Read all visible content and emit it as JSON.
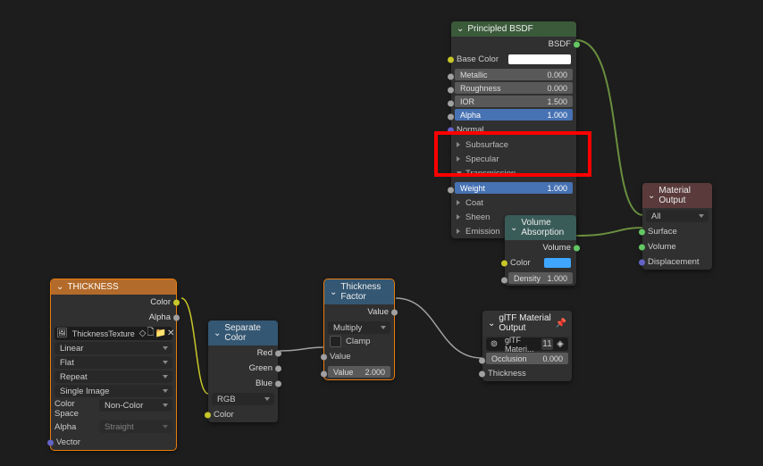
{
  "bsdf": {
    "title": "Principled BSDF",
    "out": "BSDF",
    "base_color_label": "Base Color",
    "base_color": "#ffffff",
    "metallic_label": "Metallic",
    "metallic": "0.000",
    "roughness_label": "Roughness",
    "roughness": "0.000",
    "ior_label": "IOR",
    "ior": "1.500",
    "alpha_label": "Alpha",
    "alpha": "1.000",
    "normal_label": "Normal",
    "subsurface_label": "Subsurface",
    "specular_label": "Specular",
    "transmission_label": "Transmission",
    "weight_label": "Weight",
    "weight": "1.000",
    "coat_label": "Coat",
    "sheen_label": "Sheen",
    "emission_label": "Emission"
  },
  "matout": {
    "title": "Material Output",
    "target": "All",
    "surface": "Surface",
    "volume": "Volume",
    "disp": "Displacement"
  },
  "volabs": {
    "title": "Volume Absorption",
    "out": "Volume",
    "color_label": "Color",
    "color": "#3fa7ff",
    "density_label": "Density",
    "density": "1.000"
  },
  "thickimg": {
    "title": "THICKNESS",
    "out_color": "Color",
    "out_alpha": "Alpha",
    "texname": "ThicknessTexture",
    "interp": "Linear",
    "proj": "Flat",
    "ext": "Repeat",
    "frames": "Single Image",
    "cs_label": "Color Space",
    "cs": "Non-Color",
    "alpha_label": "Alpha",
    "alpha_mode": "Straight",
    "vector": "Vector"
  },
  "sep": {
    "title": "Separate Color",
    "r": "Red",
    "g": "Green",
    "b": "Blue",
    "mode": "RGB",
    "in": "Color"
  },
  "tf": {
    "title": "Thickness Factor",
    "out": "Value",
    "op": "Multiply",
    "clamp": "Clamp",
    "value_label": "Value",
    "value_in": "Value",
    "value": "2.000"
  },
  "gltf": {
    "title": "glTF Material Output",
    "grp": "glTF Materi...",
    "users": "11",
    "occ_label": "Occlusion",
    "occ": "0.000",
    "thick": "Thickness"
  }
}
